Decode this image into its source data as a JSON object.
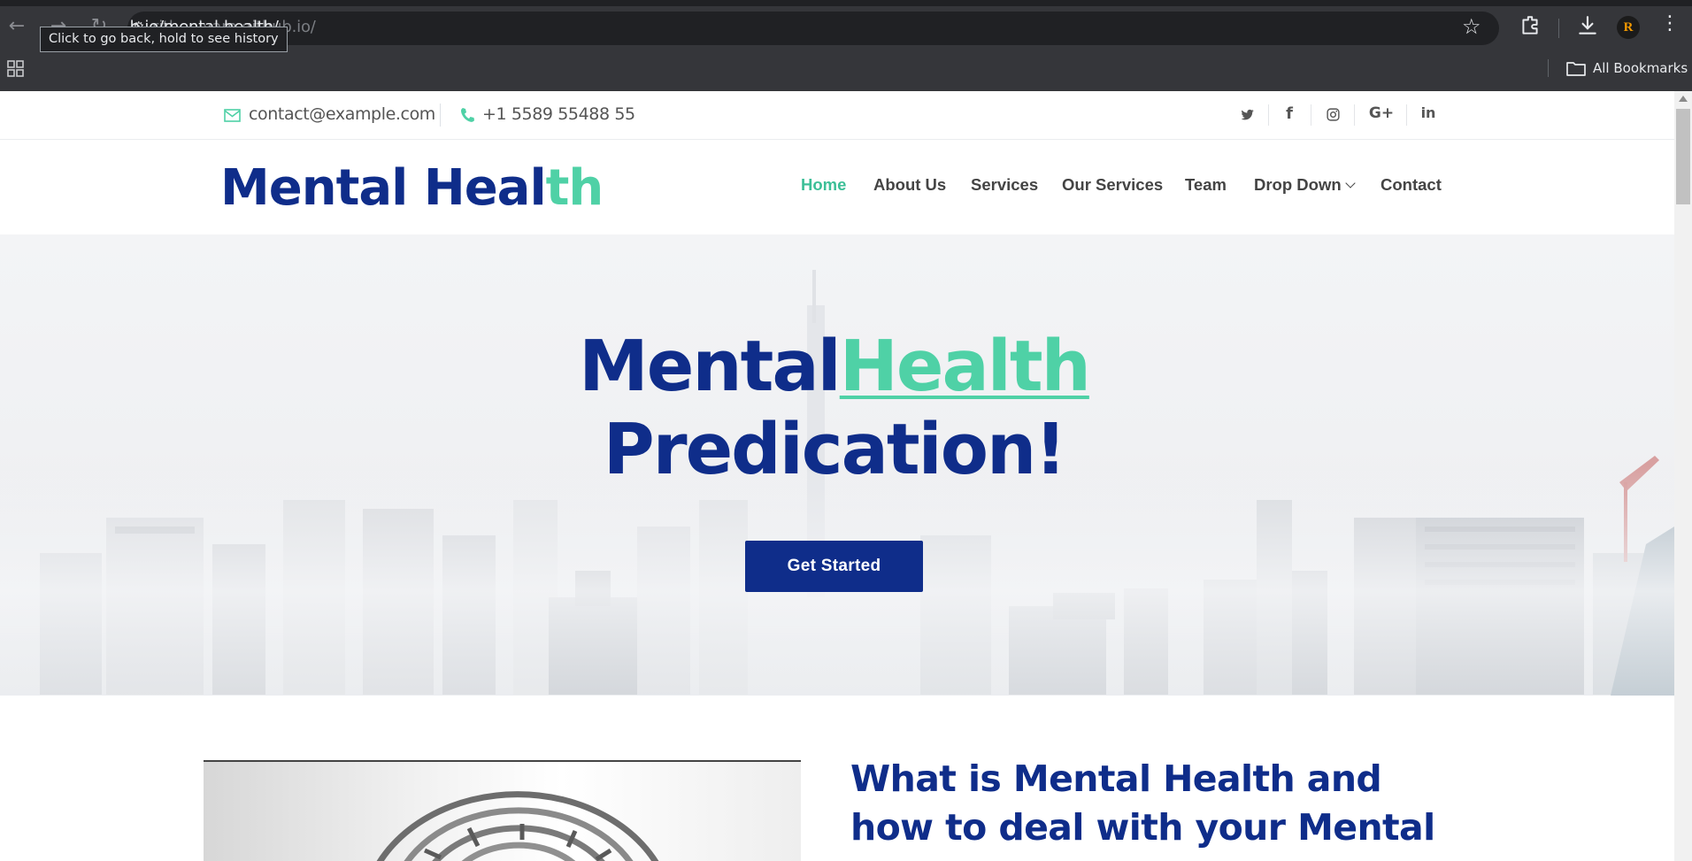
{
  "browser": {
    "url_visible": "b.io/mental-health/",
    "tooltip": "Click to go back, hold to see history",
    "bookmarks_label": "All Bookmarks",
    "avatar_letter": "R"
  },
  "topbar": {
    "email": "contact@example.com",
    "phone": "+1 5589 55488 55",
    "social": [
      "twitter-icon",
      "facebook-icon",
      "instagram-icon",
      "google-plus-icon",
      "linkedin-icon"
    ]
  },
  "header": {
    "logo_main": "Mental Heal",
    "logo_accent": "th",
    "nav": [
      {
        "label": "Home",
        "active": true
      },
      {
        "label": "About Us"
      },
      {
        "label": "Services"
      },
      {
        "label": "Our Services"
      },
      {
        "label": "Team"
      },
      {
        "label": "Drop Down"
      },
      {
        "label": "Contact"
      }
    ]
  },
  "hero": {
    "title_part1": "Mental",
    "title_part2": "Health",
    "title_line2": "Predication!",
    "cta": "Get Started"
  },
  "about": {
    "title": "What is Mental Health and how to deal with your Mental"
  },
  "colors": {
    "brand": "#0f2d8a",
    "accent": "#4fd1a6",
    "chrome_bg": "#35363a"
  }
}
